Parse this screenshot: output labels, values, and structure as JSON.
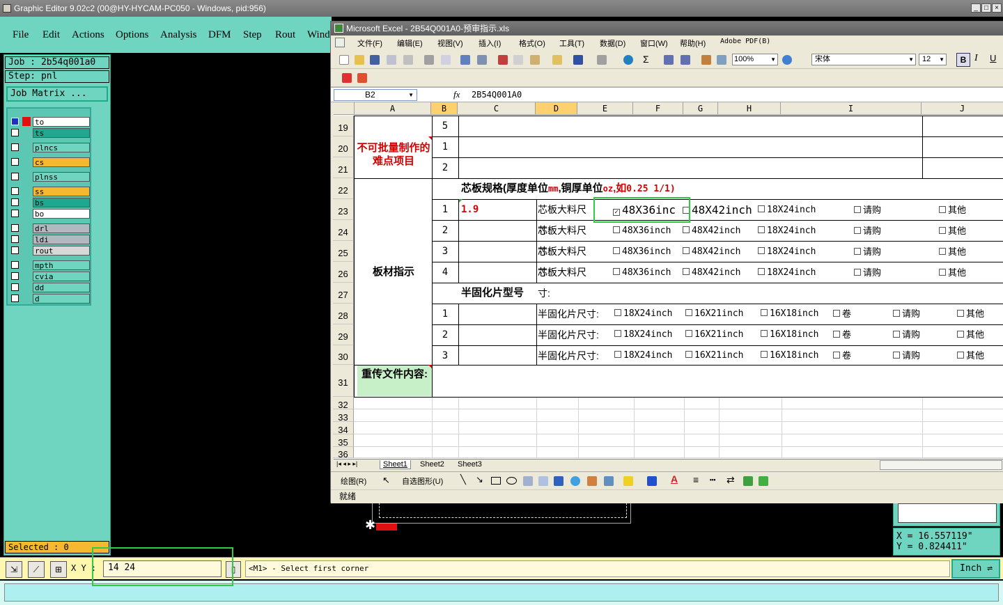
{
  "ge": {
    "title": "Graphic Editor 9.02c2 (00@HY-HYCAM-PC050 - Windows, pid:956)",
    "menu": [
      "File",
      "Edit",
      "Actions",
      "Options",
      "Analysis",
      "DFM",
      "Step",
      "Rout",
      "Wind"
    ],
    "job": "Job : 2b54q001a0",
    "step": "Step: pnl",
    "job_matrix": "Job Matrix ...",
    "layers": [
      {
        "name": "to",
        "color": "#ffffff"
      },
      {
        "name": "ts",
        "color": "#1fa890"
      },
      {
        "name": "plncs",
        "color": "#6fd4c0"
      },
      {
        "name": "cs",
        "color": "#f5b830"
      },
      {
        "name": "plnss",
        "color": "#6fd4c0"
      },
      {
        "name": "ss",
        "color": "#f5b830"
      },
      {
        "name": "bs",
        "color": "#1fa890"
      },
      {
        "name": "bo",
        "color": "#ffffff"
      },
      {
        "name": "drl",
        "color": "#b0b8c0"
      },
      {
        "name": "ldi",
        "color": "#b0b8c0"
      },
      {
        "name": "rout",
        "color": "#d8d8d8"
      },
      {
        "name": "mpth",
        "color": "#6fd4c0"
      },
      {
        "name": "cvia",
        "color": "#6fd4c0"
      },
      {
        "name": "dd",
        "color": "#6fd4c0"
      },
      {
        "name": "d",
        "color": "#6fd4c0"
      }
    ],
    "selected": "Selected : 0",
    "xy_label": "X Y :",
    "xy_value": "14 24",
    "prompt": "<M1> - Select first corner",
    "unit": "Inch",
    "coord_x": "X  =  16.557119\"",
    "coord_y": "Y  =  0.824411\""
  },
  "xl": {
    "title": "Microsoft Excel - 2B54Q001A0-预审指示.xls",
    "menu": [
      "文件(F)",
      "编辑(E)",
      "视图(V)",
      "插入(I)",
      "格式(O)",
      "工具(T)",
      "数据(D)",
      "窗口(W)",
      "帮助(H)",
      "Adobe PDF(B)"
    ],
    "zoom": "100%",
    "font": "宋体",
    "size": "12",
    "namebox": "B2",
    "formula": "2B54Q001A0",
    "columns": [
      "A",
      "B",
      "C",
      "D",
      "E",
      "F",
      "G",
      "H",
      "I",
      "J"
    ],
    "rows": [
      "19",
      "20",
      "21",
      "22",
      "23",
      "24",
      "25",
      "26",
      "27",
      "28",
      "29",
      "30",
      "31",
      "32",
      "33",
      "34",
      "35",
      "36"
    ],
    "cells": {
      "r19b": "5",
      "r20b": "1",
      "r21b": "2",
      "difficult": "不可批量制作的难点项目",
      "core_spec": "芯板规格(厚度单位",
      "core_mm": "mm",
      "core_mid": ",铜厚单位",
      "core_oz": "oz",
      "core_eg": ",如",
      "core_tail": "0.25 1/1)",
      "board": "板材指示",
      "n1": "1",
      "n2": "2",
      "n3": "3",
      "n4": "4",
      "thick": "1.9",
      "core_size": "芯板大料尺寸:",
      "s48x36": "48X36inch",
      "s48x36_big": "48X36inc",
      "s48x42": "48X42inch",
      "s18x24": "18X24inch",
      "buy": "请购",
      "other": "其他",
      "prepreg_type": "半固化片型号",
      "pp_size": "半固化片尺寸:",
      "pp18x24": "18X24inch",
      "pp16x21": "16X21inch",
      "pp16x18": "16X18inch",
      "roll": "卷",
      "p1": "1",
      "p2": "2",
      "p3": "3",
      "reupload": "重传文件内容:"
    },
    "tabs": [
      "Sheet1",
      "Sheet2",
      "Sheet3"
    ],
    "draw_label": "绘图(R)",
    "autoshape": "自选图形(U)",
    "status": "就绪"
  }
}
